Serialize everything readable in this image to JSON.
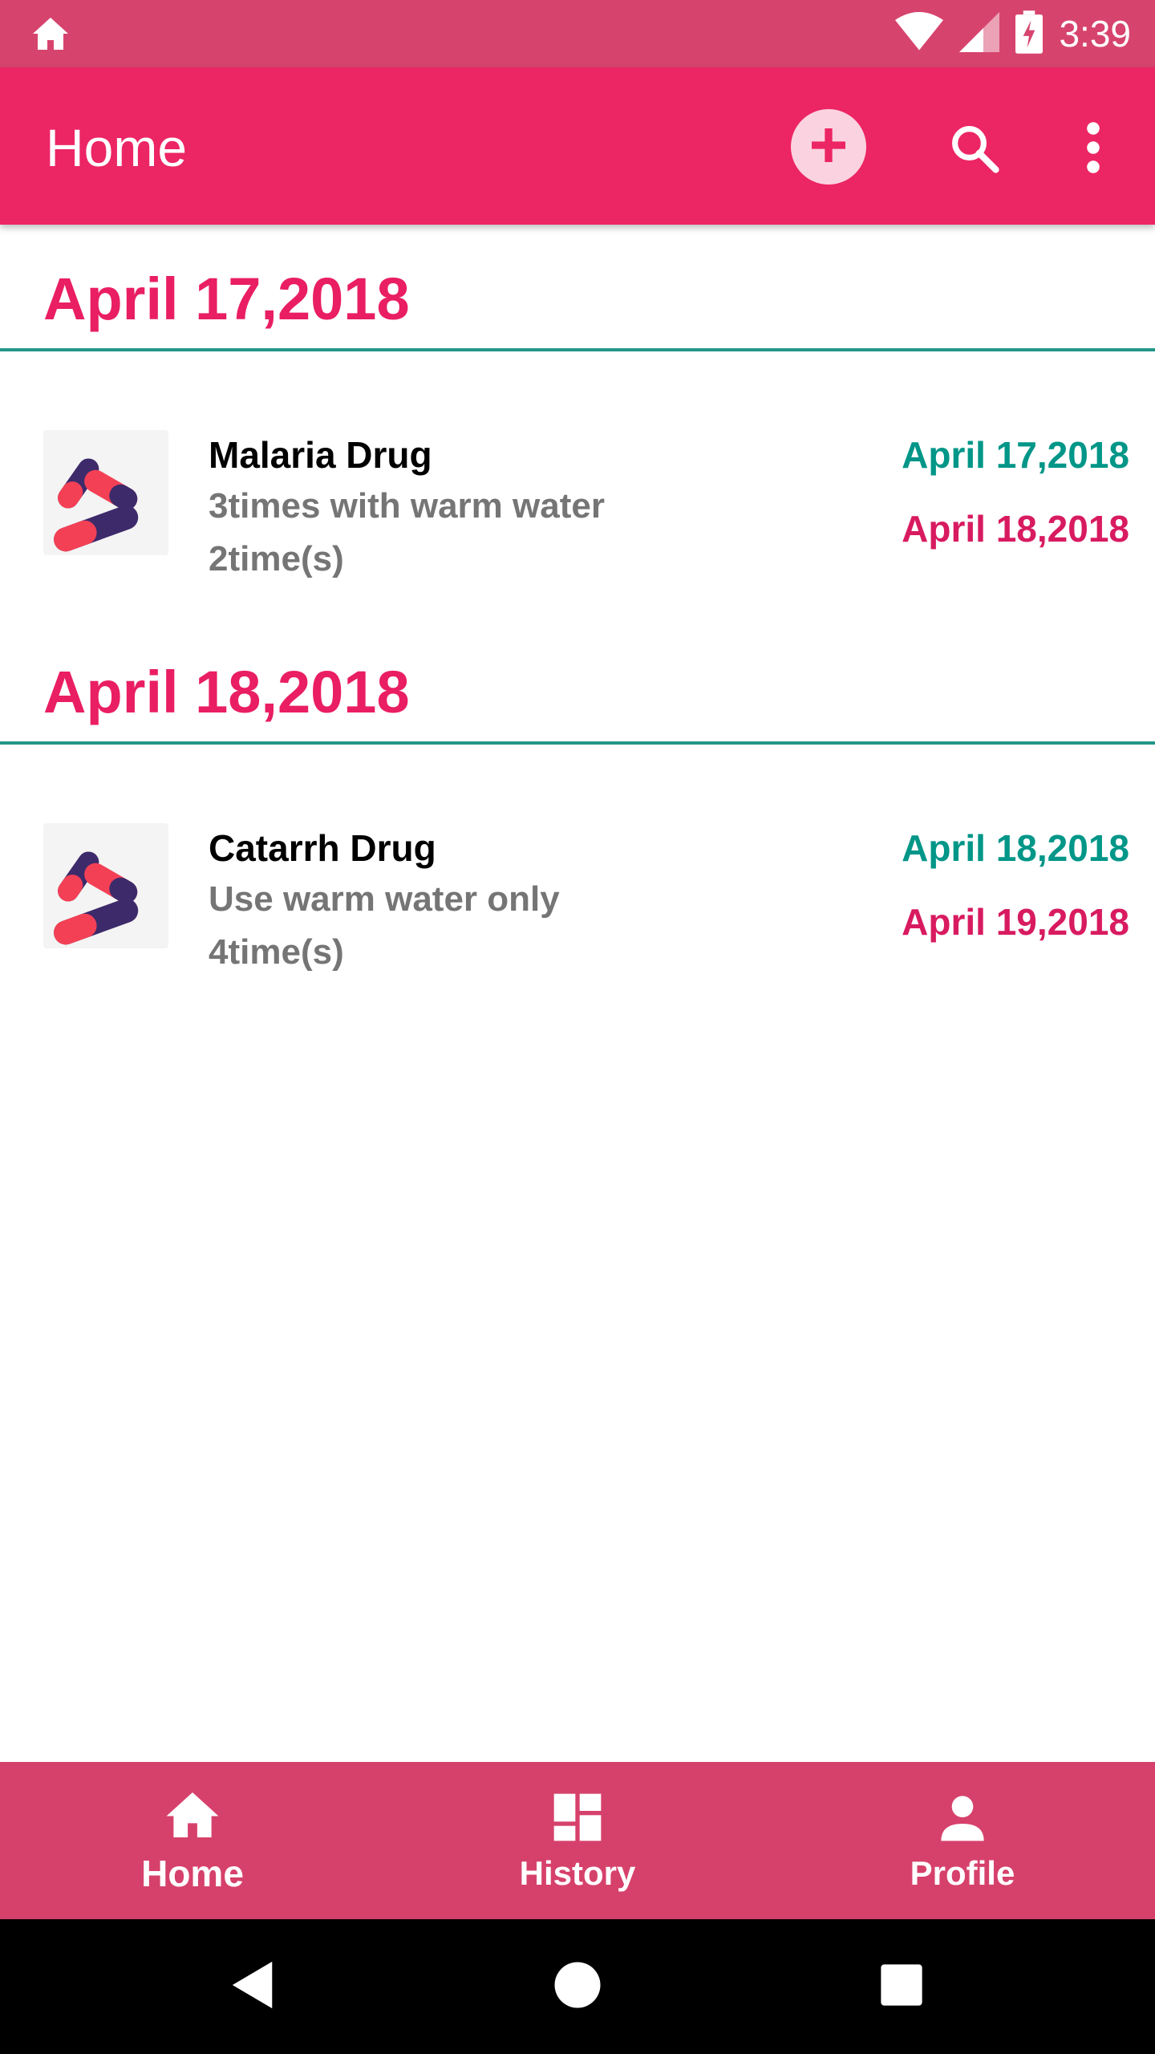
{
  "status_bar": {
    "time": "3:39",
    "icons": [
      "home-icon",
      "wifi-icon",
      "signal-icon",
      "battery-charging-icon"
    ]
  },
  "app_bar": {
    "title": "Home",
    "actions": [
      "add-circle-icon",
      "search-icon",
      "more-vert-icon"
    ]
  },
  "sections": [
    {
      "date": "April 17,2018",
      "items": [
        {
          "name": "Malaria Drug",
          "note": "3times with warm water",
          "times": "2time(s)",
          "start_date": "April 17,2018",
          "end_date": "April 18,2018"
        }
      ]
    },
    {
      "date": "April 18,2018",
      "items": [
        {
          "name": "Catarrh Drug",
          "note": "Use warm water only",
          "times": "4time(s)",
          "start_date": "April 18,2018",
          "end_date": "April 19,2018"
        }
      ]
    }
  ],
  "bottom_nav": {
    "items": [
      {
        "label": "Home",
        "icon": "home-icon",
        "active": true
      },
      {
        "label": "History",
        "icon": "dashboard-icon",
        "active": false
      },
      {
        "label": "Profile",
        "icon": "person-icon",
        "active": false
      }
    ]
  },
  "system_nav": {
    "buttons": [
      "back-icon",
      "home-circle-icon",
      "recents-icon"
    ]
  },
  "colors": {
    "status_bar": "#d6446d",
    "app_bar": "#ec2565",
    "section_title": "#e91e63",
    "divider": "#23968a",
    "start_date": "#009688",
    "end_date": "#d81b60",
    "bottom_nav": "#d6416b"
  }
}
